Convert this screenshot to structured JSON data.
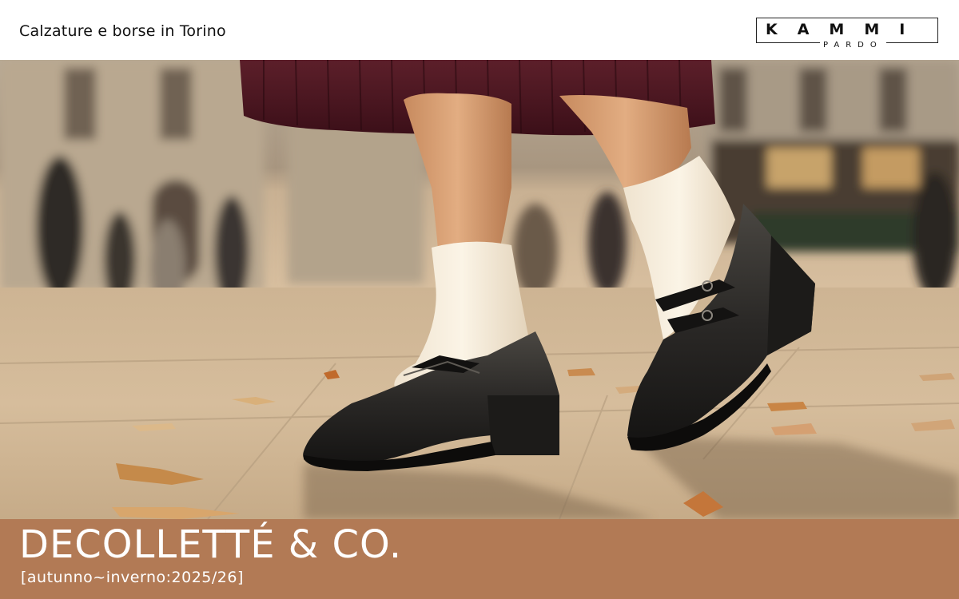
{
  "header": {
    "tagline": "Calzature e borse in Torino",
    "logo_main": "KAMMI",
    "logo_sub": "PARDO"
  },
  "photo": {
    "subject": "legs-in-mary-jane-shoes-and-white-socks-on-city-square"
  },
  "banner": {
    "title": "DECOLLETTÉ & CO.",
    "subtitle": "[autunno~inverno:2025/26]",
    "background_color": "#b27a55"
  }
}
